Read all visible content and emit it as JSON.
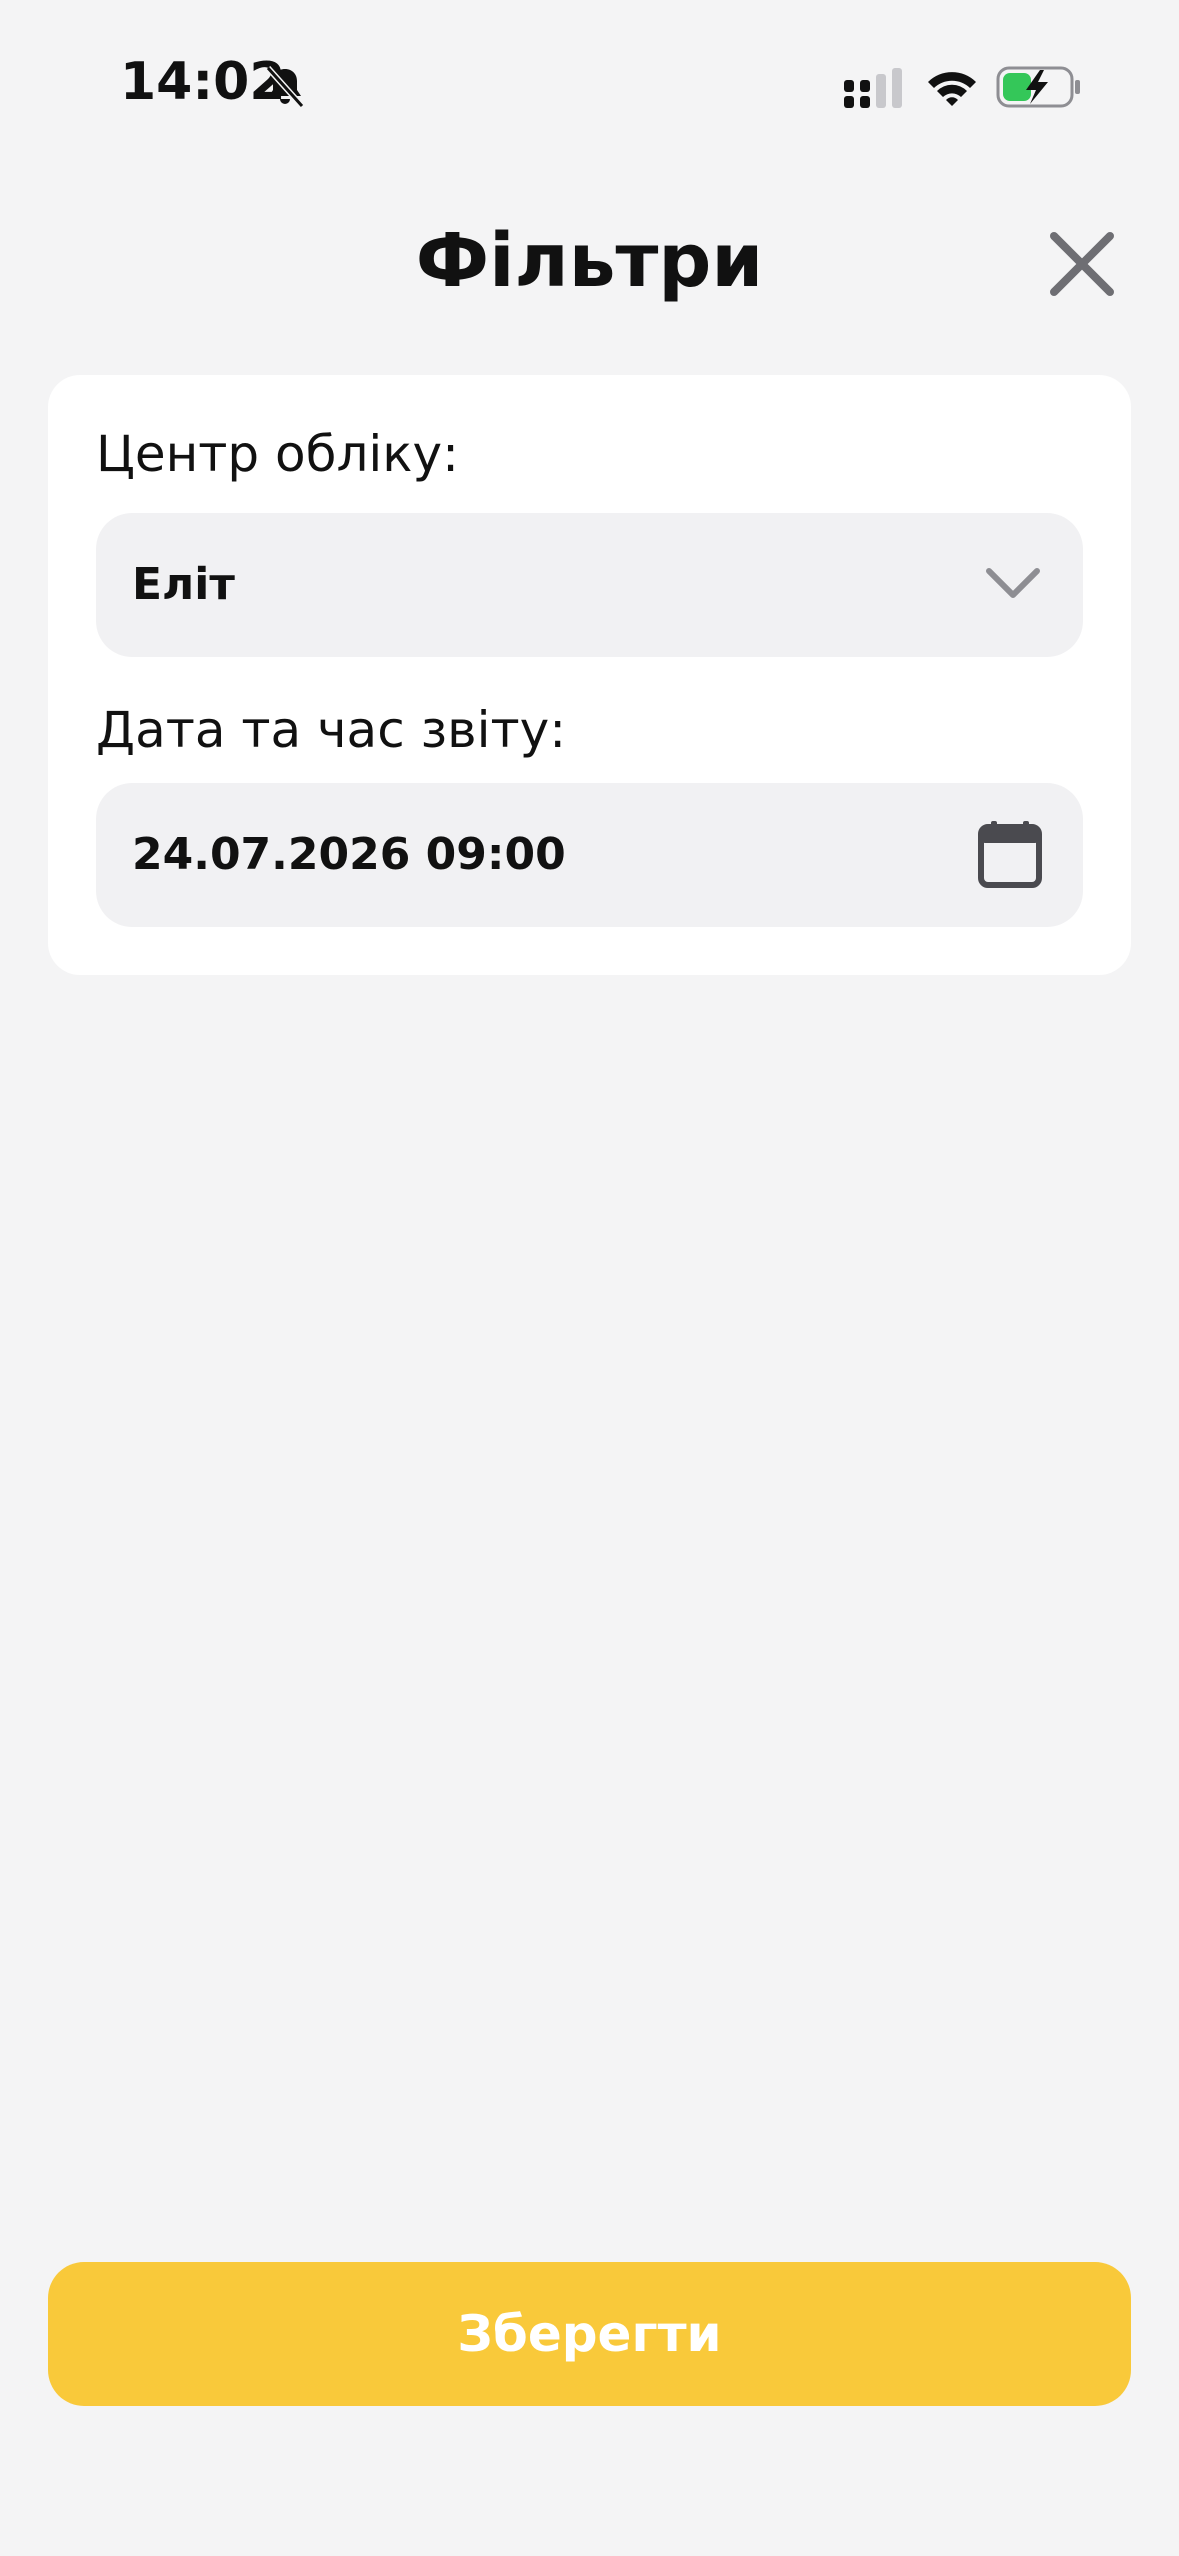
{
  "status_bar": {
    "time": "14:02",
    "icons": [
      "bell-slash-icon",
      "cellular-signal-icon",
      "wifi-icon",
      "battery-charging-icon"
    ]
  },
  "header": {
    "title": "Фільтри",
    "close_icon": "close-icon"
  },
  "filters": {
    "center": {
      "label": "Центр обліку:",
      "value": "Еліт",
      "icon": "chevron-down-icon"
    },
    "report_datetime": {
      "label": "Дата та час звіту:",
      "value": "24.07.2026 09:00",
      "icon": "calendar-icon"
    }
  },
  "actions": {
    "save_label": "Зберегти"
  },
  "colors": {
    "background": "#f4f4f5",
    "card": "#ffffff",
    "field": "#f1f1f3",
    "accent": "#f9c93a",
    "battery_charge": "#34c759"
  }
}
